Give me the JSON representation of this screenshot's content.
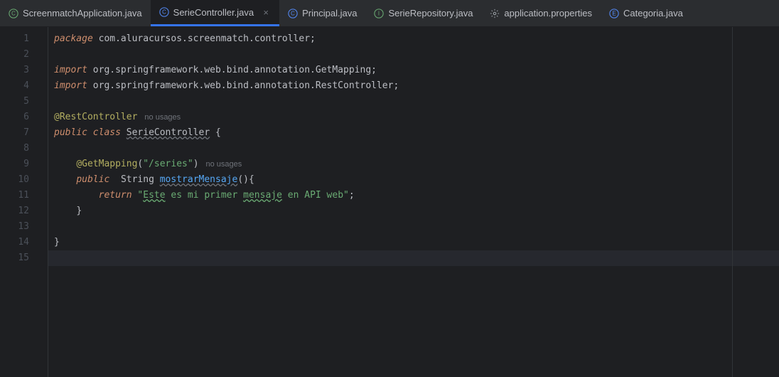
{
  "tabs": [
    {
      "label": "ScreenmatchApplication.java",
      "icon": "C",
      "iconColor": "#6aab73",
      "active": false
    },
    {
      "label": "SerieController.java",
      "icon": "C",
      "iconColor": "#548af7",
      "active": true
    },
    {
      "label": "Principal.java",
      "icon": "C",
      "iconColor": "#548af7",
      "active": false
    },
    {
      "label": "SerieRepository.java",
      "icon": "I",
      "iconColor": "#6aab73",
      "active": false
    },
    {
      "label": "application.properties",
      "icon": "gear",
      "iconColor": "#9aa0a6",
      "active": false
    },
    {
      "label": "Categoria.java",
      "icon": "E",
      "iconColor": "#548af7",
      "active": false
    }
  ],
  "code": {
    "l1": {
      "kw": "package",
      "rest": " com.aluracursos.screenmatch.controller;"
    },
    "l3": {
      "kw": "import",
      "rest1": " org.springframework.web.bind.annotation.",
      "cls": "GetMapping",
      "semi": ";"
    },
    "l4": {
      "kw": "import",
      "rest1": " org.springframework.web.bind.annotation.",
      "cls": "RestController",
      "semi": ";"
    },
    "l6": {
      "ann": "@RestController",
      "hint": "no usages"
    },
    "l7": {
      "kw1": "public",
      "kw2": "class",
      "name": "SerieController",
      "brace": " {"
    },
    "l9": {
      "pad": "    ",
      "ann": "@GetMapping",
      "open": "(",
      "str": "\"/series\"",
      "close": ")",
      "hint": "no usages"
    },
    "l10": {
      "pad": "    ",
      "kw1": "public",
      "gap": "  ",
      "type": "String ",
      "fn": "mostrarMensaje",
      "sig": "(){"
    },
    "l11": {
      "pad": "        ",
      "kw": "return",
      "sp": " ",
      "q1": "\"",
      "t1": "Este",
      "mid": " es mi primer ",
      "t2": "mensaje",
      "end": " en API web",
      "q2": "\"",
      "semi": ";"
    },
    "l12": {
      "pad": "    ",
      "brace": "}"
    },
    "l14": {
      "brace": "}"
    }
  },
  "lineNumbers": [
    "1",
    "2",
    "3",
    "4",
    "5",
    "6",
    "7",
    "8",
    "9",
    "10",
    "11",
    "12",
    "13",
    "14",
    "15"
  ]
}
